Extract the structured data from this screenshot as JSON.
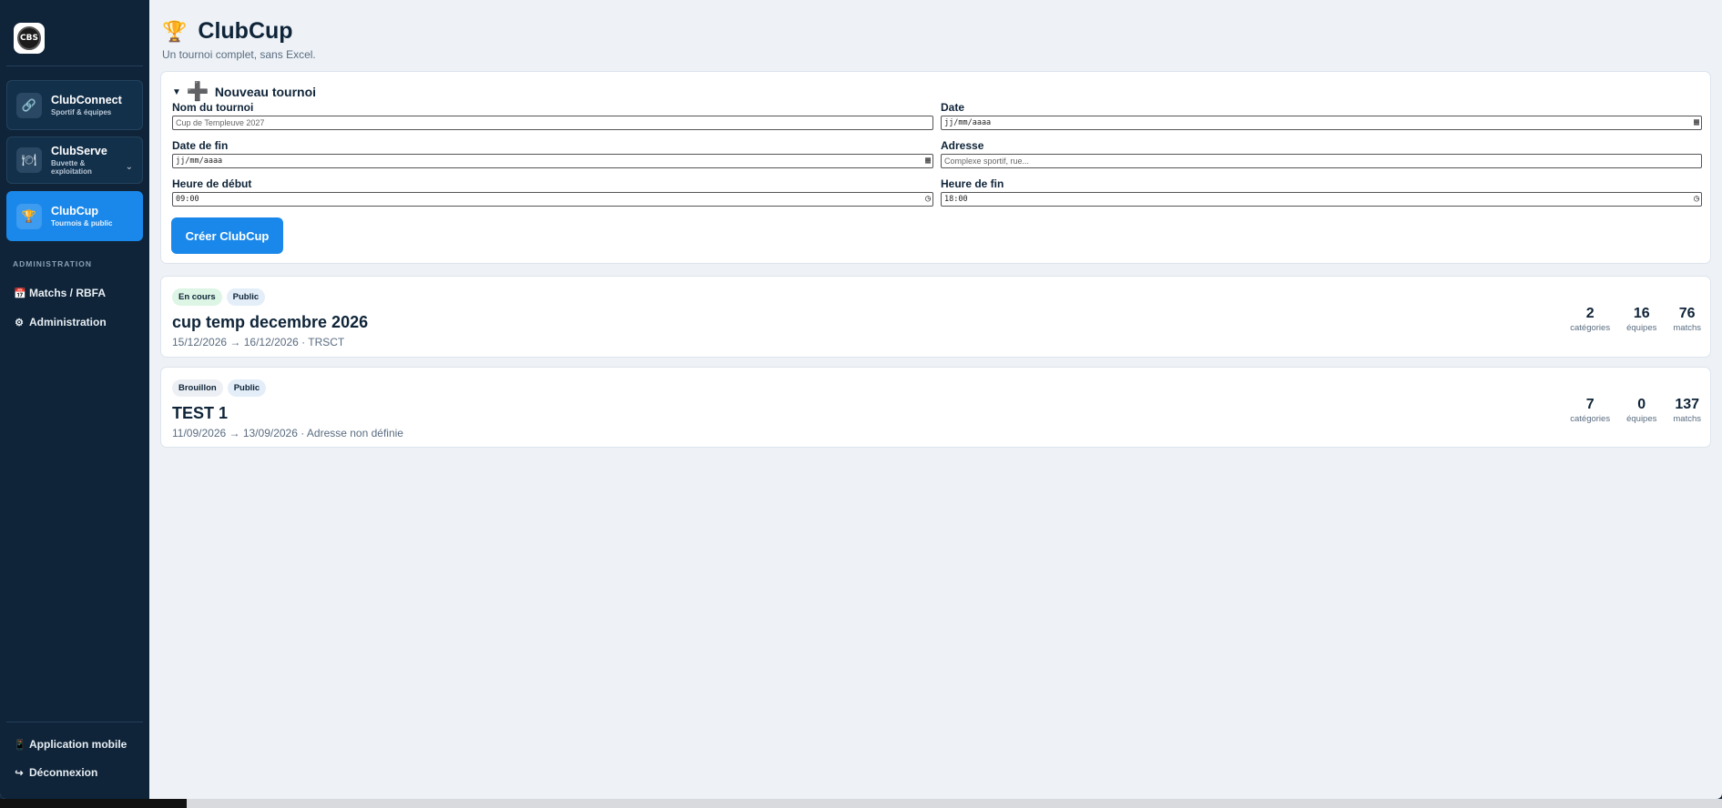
{
  "sidebar": {
    "logo_text": "CBS",
    "apps": [
      {
        "name": "ClubConnect",
        "sub": "Sportif & équipes",
        "icon": "🔗"
      },
      {
        "name": "ClubServe",
        "sub": "Buvette & exploitation",
        "icon": "🍽",
        "chevron": "⌄"
      },
      {
        "name": "ClubCup",
        "sub": "Tournois & public",
        "icon": "🏆"
      }
    ],
    "section_label": "ADMINISTRATION",
    "nav": [
      {
        "label": "Matchs / RBFA",
        "icon": "📅"
      },
      {
        "label": "Administration",
        "icon": "⚙"
      }
    ],
    "bottom": [
      {
        "label": "Application mobile",
        "icon": "📱"
      },
      {
        "label": "Déconnexion",
        "icon": "↪"
      }
    ]
  },
  "page": {
    "title": "ClubCup",
    "subtitle": "Un tournoi complet, sans Excel.",
    "trophy_icon": "🏆"
  },
  "form": {
    "toggle": "▼",
    "plus": "➕",
    "heading": "Nouveau tournoi",
    "fields": {
      "name": {
        "label": "Nom du tournoi",
        "placeholder": "Cup de Templeuve 2027"
      },
      "date": {
        "label": "Date",
        "value": "jj/mm/aaaa"
      },
      "end_date": {
        "label": "Date de fin",
        "value": "jj/mm/aaaa"
      },
      "address": {
        "label": "Adresse",
        "placeholder": "Complexe sportif, rue..."
      },
      "start_time": {
        "label": "Heure de début",
        "value": "09:00"
      },
      "end_time": {
        "label": "Heure de fin",
        "value": "18:00"
      }
    },
    "submit": "Créer ClubCup"
  },
  "tournaments": [
    {
      "badges": [
        "En cours",
        "Public"
      ],
      "name": "cup temp decembre 2026",
      "meta": "15/12/2026 → 16/12/2026 · TRSCT",
      "stats": [
        {
          "value": "2",
          "label": "catégories"
        },
        {
          "value": "16",
          "label": "équipes"
        },
        {
          "value": "76",
          "label": "matchs"
        }
      ]
    },
    {
      "badges": [
        "Brouillon",
        "Public"
      ],
      "name": "TEST 1",
      "meta": "11/09/2026 → 13/09/2026 · Adresse non définie",
      "stats": [
        {
          "value": "7",
          "label": "catégories"
        },
        {
          "value": "0",
          "label": "équipes"
        },
        {
          "value": "137",
          "label": "matchs"
        }
      ]
    }
  ],
  "colors": {
    "sidebar_bg": "#0f2438",
    "accent": "#1a88ea",
    "page_bg": "#eef2f7",
    "plus_purple": "#6b3fc4"
  }
}
